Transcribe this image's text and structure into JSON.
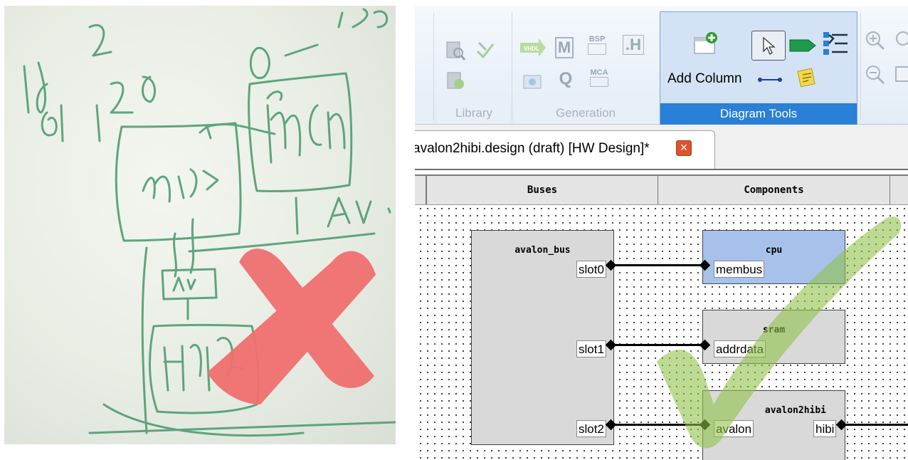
{
  "ribbon": {
    "groups": [
      {
        "label": "Library"
      },
      {
        "label": "Generation"
      },
      {
        "label": "Diagram Tools"
      }
    ],
    "icons": {
      "vhdl": "VHDL",
      "bsp": "BSP",
      "header": ".H",
      "mca": "MCA"
    },
    "add_column_label": "Add Column"
  },
  "tab": {
    "title": "avalon2hibi.design (draft) [HW Design]*",
    "close_glyph": "✕"
  },
  "design": {
    "columns": [
      {
        "label": "Buses"
      },
      {
        "label": "Components"
      }
    ],
    "bus": {
      "name": "avalon_bus",
      "ports": [
        "slot0",
        "slot1",
        "slot2"
      ]
    },
    "components": [
      {
        "name": "cpu",
        "port": "membus",
        "color": "#a7c1ea"
      },
      {
        "name": "sram",
        "port": "addrdata",
        "color": "#d9d9d9"
      },
      {
        "name": "avalon2hibi",
        "port": "avalon",
        "port2": "hibi",
        "color": "#d9d9d9"
      }
    ]
  },
  "overlay": {
    "cross_color": "#f07070",
    "check_color": "#8fc24a"
  }
}
